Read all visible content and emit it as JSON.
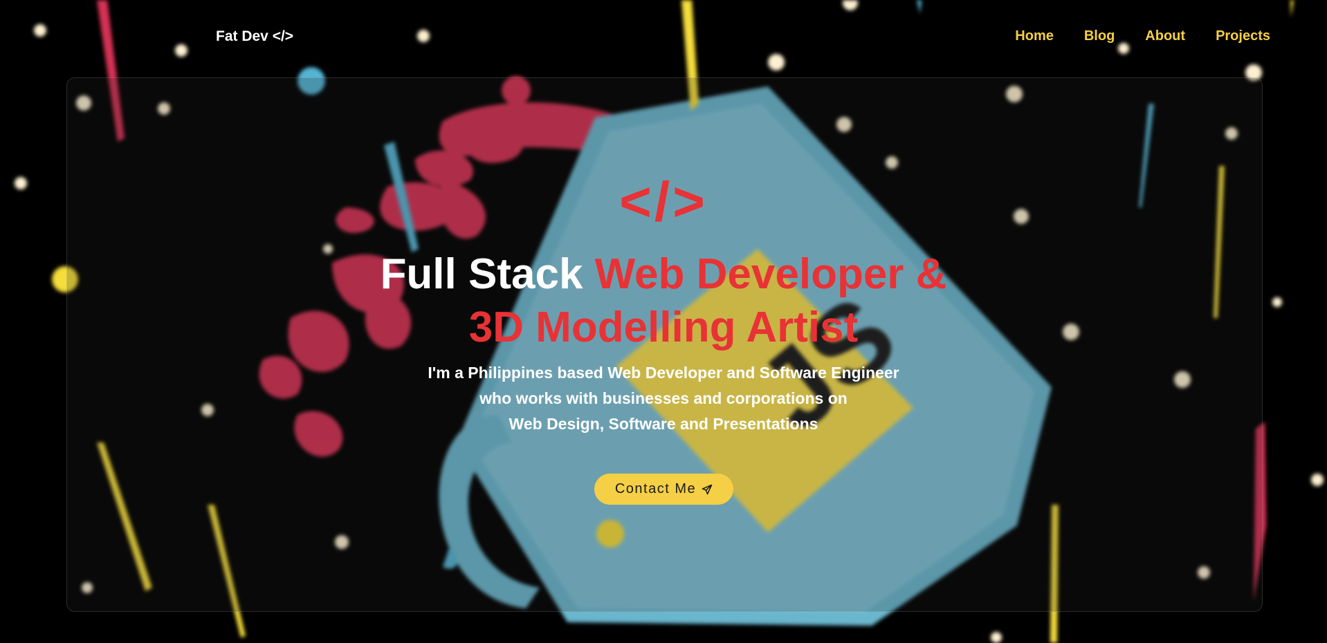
{
  "navbar": {
    "brand": "Fat Dev </>",
    "links": [
      {
        "label": "Home"
      },
      {
        "label": "Blog"
      },
      {
        "label": "About"
      },
      {
        "label": "Projects"
      }
    ]
  },
  "hero": {
    "symbol": "</>",
    "headline_white": "Full Stack ",
    "headline_red_line1": "Web Developer &",
    "headline_red_line2": "3D Modelling Artist",
    "subtext_lines": [
      "I'm a Philippines based Web Developer and Software Engineer",
      "who works with businesses and corporations on",
      "Web Design, Software and Presentations"
    ],
    "cta_label": "Contact Me",
    "cta_icon": "send-icon"
  },
  "colors": {
    "background": "#000000",
    "accent_yellow": "#f5cf45",
    "accent_red": "#e83235",
    "mug_blue": "#6ab6cd",
    "splash_pink": "#e7355a",
    "star_cream": "#fdf0d0"
  },
  "background_art": {
    "illustration": "javascript-coffee-mug-illustration",
    "mug_logo_text": "JS"
  }
}
